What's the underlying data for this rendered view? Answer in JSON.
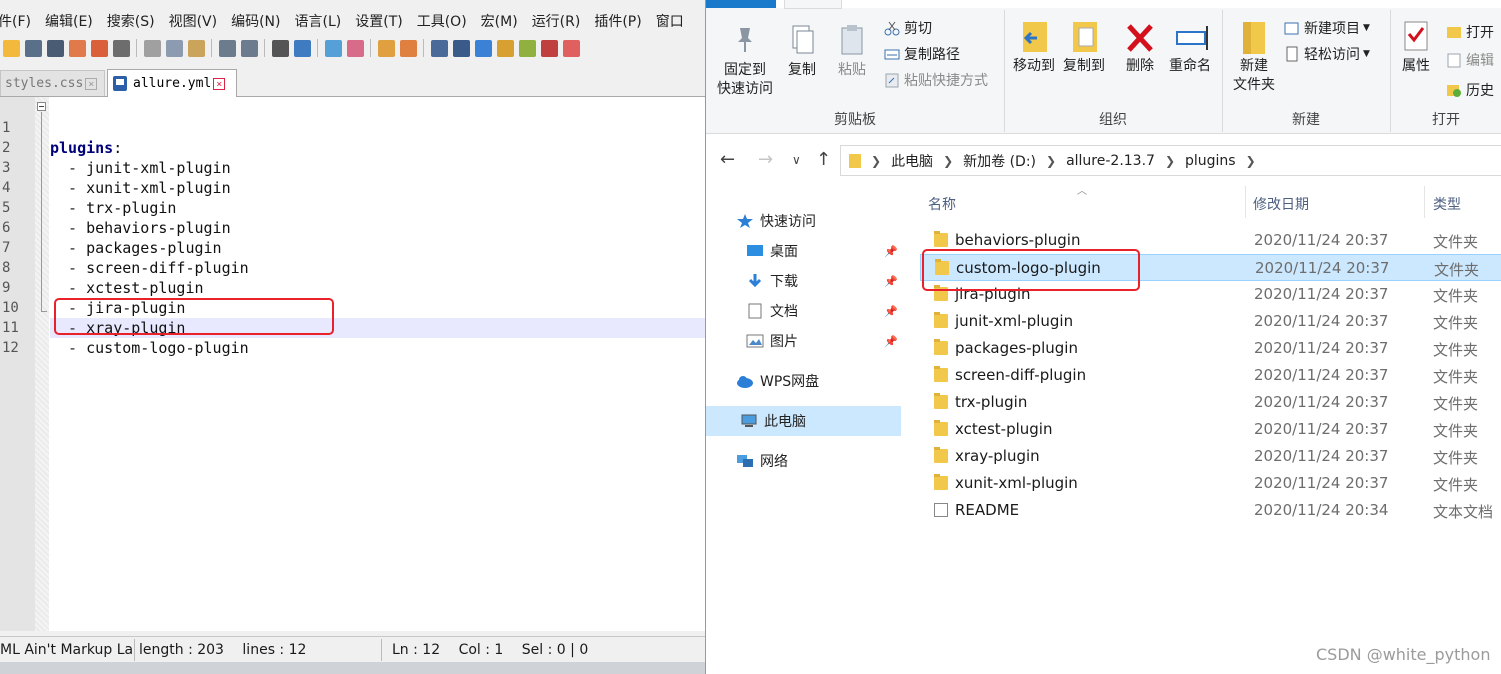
{
  "npp": {
    "menu": [
      "件(F)",
      "编辑(E)",
      "搜索(S)",
      "视图(V)",
      "编码(N)",
      "语言(L)",
      "设置(T)",
      "工具(O)",
      "宏(M)",
      "运行(R)",
      "插件(P)",
      "窗口"
    ],
    "tabs": [
      {
        "label": "styles.css",
        "close": "×"
      },
      {
        "label": "allure.yml",
        "close": "×"
      }
    ],
    "lines": [
      {
        "num": "1",
        "key": "plugins",
        "colon": ":"
      },
      {
        "num": "2",
        "dash": "  - ",
        "text": "junit-xml-plugin"
      },
      {
        "num": "3",
        "dash": "  - ",
        "text": "xunit-xml-plugin"
      },
      {
        "num": "4",
        "dash": "  - ",
        "text": "trx-plugin"
      },
      {
        "num": "5",
        "dash": "  - ",
        "text": "behaviors-plugin"
      },
      {
        "num": "6",
        "dash": "  - ",
        "text": "packages-plugin"
      },
      {
        "num": "7",
        "dash": "  - ",
        "text": "screen-diff-plugin"
      },
      {
        "num": "8",
        "dash": "  - ",
        "text": "xctest-plugin"
      },
      {
        "num": "9",
        "dash": "  - ",
        "text": "jira-plugin"
      },
      {
        "num": "10",
        "dash": "  - ",
        "text": "xray-plugin"
      },
      {
        "num": "11",
        "dash": "  - ",
        "text": "custom-logo-plugin"
      },
      {
        "num": "12",
        "text": ""
      }
    ],
    "status": {
      "lang": "ML Ain't Markup La",
      "length": "length : 203",
      "lines": "lines : 12",
      "ln": "Ln : 12",
      "col": "Col : 1",
      "sel": "Sel : 0 | 0"
    }
  },
  "explorer": {
    "ribbon": {
      "clipboard": {
        "pin_label_1": "固定到",
        "pin_label_2": "快速访问",
        "copy": "复制",
        "paste": "粘贴",
        "cut": "剪切",
        "copy_path": "复制路径",
        "paste_shortcut": "粘贴快捷方式",
        "group": "剪贴板"
      },
      "organize": {
        "move_to": "移动到",
        "copy_to": "复制到",
        "delete": "删除",
        "rename": "重命名",
        "group": "组织"
      },
      "new": {
        "new_folder_1": "新建",
        "new_folder_2": "文件夹",
        "new_item": "新建项目",
        "easy_access": "轻松访问",
        "group": "新建"
      },
      "open": {
        "properties": "属性",
        "open": "打开",
        "edit": "编辑",
        "history": "历史",
        "group": "打开"
      }
    },
    "address": {
      "crumbs": [
        "此电脑",
        "新加卷 (D:)",
        "allure-2.13.7",
        "plugins"
      ]
    },
    "nav": [
      {
        "label": "快速访问"
      },
      {
        "label": "桌面"
      },
      {
        "label": "下载"
      },
      {
        "label": "文档"
      },
      {
        "label": "图片"
      },
      {
        "label": "WPS网盘"
      },
      {
        "label": "此电脑"
      },
      {
        "label": "网络"
      }
    ],
    "columns": {
      "name": "名称",
      "date": "修改日期",
      "type": "类型"
    },
    "files": [
      {
        "name": "behaviors-plugin",
        "date": "2020/11/24 20:37",
        "type": "文件夹"
      },
      {
        "name": "custom-logo-plugin",
        "date": "2020/11/24 20:37",
        "type": "文件夹"
      },
      {
        "name": "jira-plugin",
        "date": "2020/11/24 20:37",
        "type": "文件夹"
      },
      {
        "name": "junit-xml-plugin",
        "date": "2020/11/24 20:37",
        "type": "文件夹"
      },
      {
        "name": "packages-plugin",
        "date": "2020/11/24 20:37",
        "type": "文件夹"
      },
      {
        "name": "screen-diff-plugin",
        "date": "2020/11/24 20:37",
        "type": "文件夹"
      },
      {
        "name": "trx-plugin",
        "date": "2020/11/24 20:37",
        "type": "文件夹"
      },
      {
        "name": "xctest-plugin",
        "date": "2020/11/24 20:37",
        "type": "文件夹"
      },
      {
        "name": "xray-plugin",
        "date": "2020/11/24 20:37",
        "type": "文件夹"
      },
      {
        "name": "xunit-xml-plugin",
        "date": "2020/11/24 20:37",
        "type": "文件夹"
      },
      {
        "name": "README",
        "date": "2020/11/24 20:34",
        "type": "文本文档"
      }
    ]
  },
  "watermark": "CSDN @white_python",
  "colors": {
    "highlight": "#e8212b",
    "selection": "#cce8ff",
    "ribbon_blue": "#1979ca"
  }
}
